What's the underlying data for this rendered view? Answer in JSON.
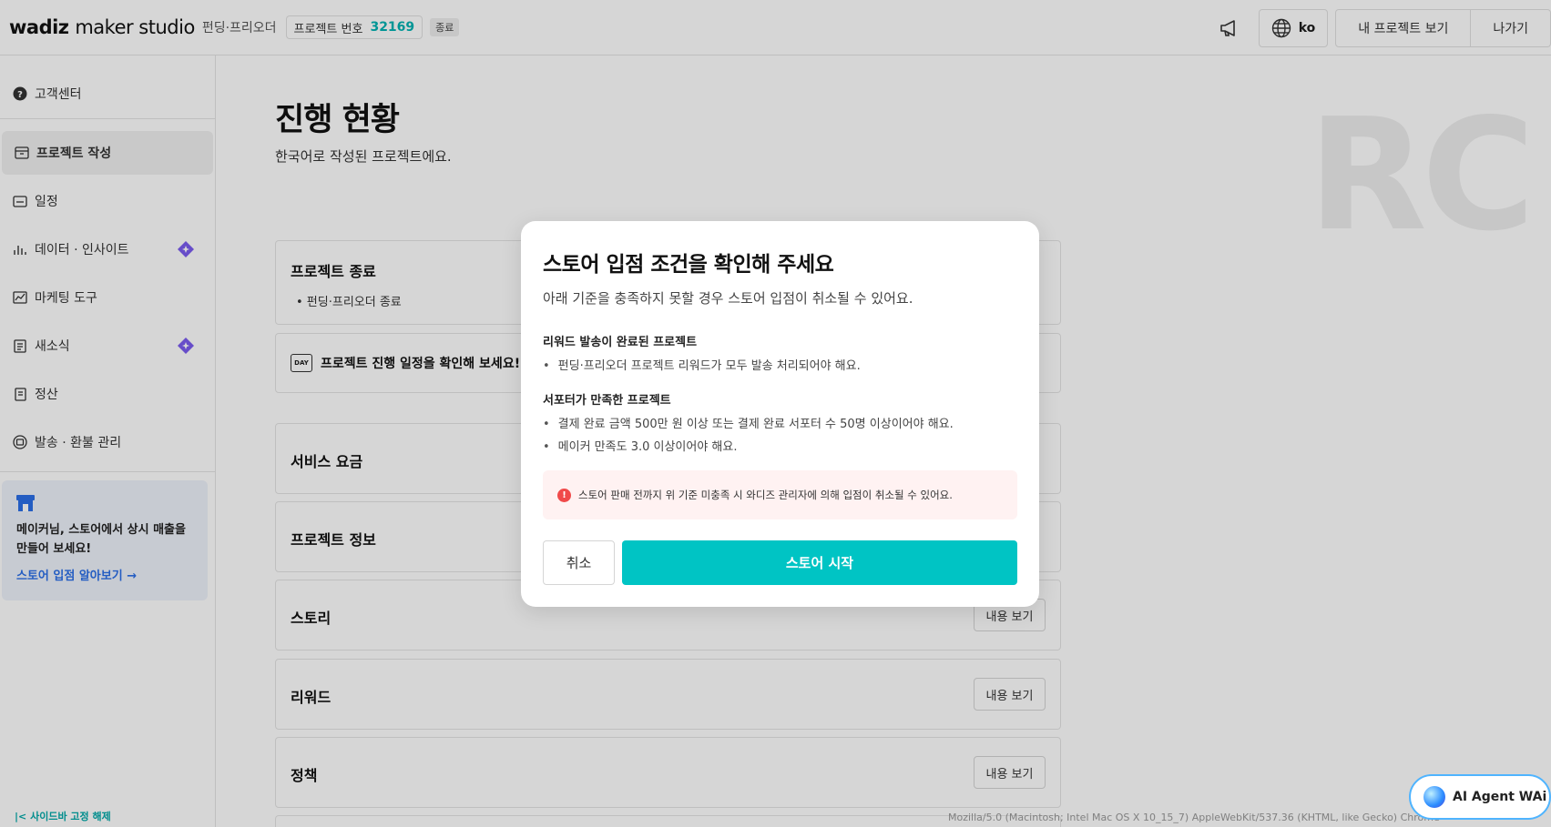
{
  "header": {
    "logo_main": "wadiz",
    "logo_studio": "maker studio",
    "logo_sub": "펀딩·프리오더",
    "project_label": "프로젝트 번호",
    "project_number": "32169",
    "status": "종료",
    "lang": "ko",
    "my_projects": "내 프로젝트 보기",
    "exit": "나가기"
  },
  "sidebar": {
    "items": [
      {
        "label": "고객센터",
        "icon": "question-circle-icon"
      },
      {
        "label": "프로젝트 작성",
        "icon": "box-icon"
      },
      {
        "label": "일정",
        "icon": "calendar-icon"
      },
      {
        "label": "데이터 · 인사이트",
        "icon": "bar-chart-icon"
      },
      {
        "label": "마케팅 도구",
        "icon": "chart-line-icon"
      },
      {
        "label": "새소식",
        "icon": "news-icon"
      },
      {
        "label": "정산",
        "icon": "receipt-icon"
      },
      {
        "label": "발송 · 환불 관리",
        "icon": "package-icon"
      }
    ],
    "promo": {
      "text": "메이커님, 스토어에서 상시 매출을 만들어 보세요!",
      "link": "스토어 입점 알아보기"
    },
    "fix_label": "사이드바 고정 해제"
  },
  "main": {
    "title": "진행 현황",
    "subtitle": "한국어로 작성된 프로젝트에요.",
    "watermark": "RC",
    "cards": {
      "project_end_title": "프로젝트 종료",
      "project_end_bullet": "• 펀딩·프리오더 종료",
      "schedule_icon": "DAY",
      "schedule_text": "프로젝트 진행 일정을 확인해 보세요!",
      "service_fee": "서비스 요금",
      "project_info": "프로젝트 정보",
      "story": "스토리",
      "reward": "리워드",
      "policy": "정책",
      "view_label": "내용 보기"
    }
  },
  "user_agent": "Mozilla/5.0 (Macintosh; Intel Mac OS X 10_15_7) AppleWebKit/537.36 (KHTML, like Gecko) Chrome",
  "ai_agent": "AI Agent WAi",
  "modal": {
    "title": "스토어 입점 조건을 확인해 주세요",
    "desc": "아래 기준을 충족하지 못할 경우 스토어 입점이 취소될 수 있어요.",
    "sec1_title": "리워드 발송이 완료된 프로젝트",
    "sec1_bullet": "펀딩·프리오더 프로젝트 리워드가 모두 발송 처리되어야 해요.",
    "sec2_title": "서포터가 만족한 프로젝트",
    "sec2_bullet1": "결제 완료 금액 500만 원 이상 또는 결제 완료 서포터 수 50명 이상이어야 해요.",
    "sec2_bullet2": "메이커 만족도 3.0 이상이어야 해요.",
    "alert": "스토어 판매 전까지 위 기준 미충족 시 와디즈 관리자에 의해 입점이 취소될 수 있어요.",
    "cancel": "취소",
    "start": "스토어 시작"
  },
  "colors": {
    "accent": "#00c4c4",
    "project_number": "#00b2b2",
    "link": "#2c6fe8",
    "alert_bg": "#fff2f2",
    "alert_icon": "#f04a4a",
    "gem": "#7b5cf0"
  }
}
